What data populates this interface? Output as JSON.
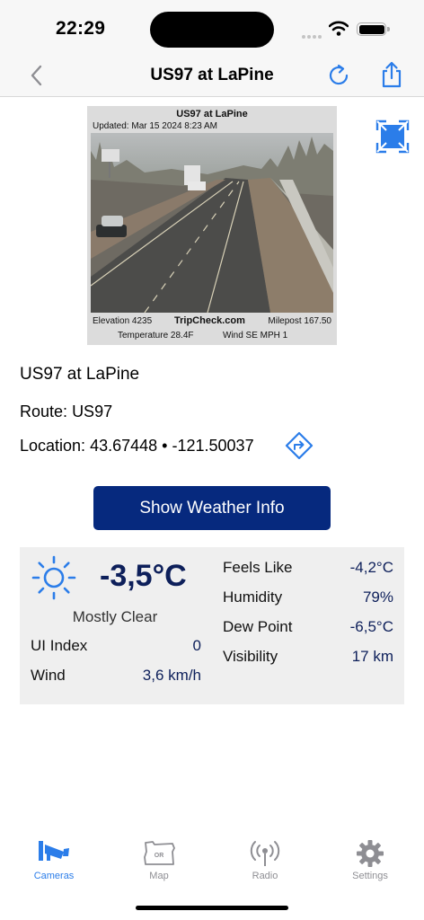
{
  "status_bar": {
    "time": "22:29"
  },
  "nav": {
    "title": "US97 at LaPine"
  },
  "camera_image": {
    "title": "US97 at LaPine",
    "updated": "Updated: Mar 15 2024  8:23 AM",
    "elevation": "Elevation 4235",
    "brand": "TripCheck.com",
    "milepost": "Milepost  167.50",
    "temperature": "Temperature 28.4F",
    "wind": "Wind SE   MPH  1"
  },
  "details": {
    "name": "US97 at LaPine",
    "route_label": "Route:",
    "route_value": "US97",
    "location_label": "Location:",
    "latitude": "43.67448",
    "separator": "•",
    "longitude": "-121.50037"
  },
  "weather_button": {
    "label": "Show Weather Info"
  },
  "weather": {
    "temperature": "-3,5°C",
    "condition": "Mostly Clear",
    "left": [
      {
        "label": "UI Index",
        "value": "0"
      },
      {
        "label": "Wind",
        "value": "3,6 km/h"
      }
    ],
    "right": [
      {
        "label": "Feels Like",
        "value": "-4,2°C"
      },
      {
        "label": "Humidity",
        "value": "79%"
      },
      {
        "label": "Dew Point",
        "value": "-6,5°C"
      },
      {
        "label": "Visibility",
        "value": "17 km"
      }
    ]
  },
  "tabs": [
    {
      "label": "Cameras",
      "icon": "camera-icon",
      "active": true
    },
    {
      "label": "Map",
      "icon": "oregon-map-icon",
      "active": false
    },
    {
      "label": "Radio",
      "icon": "radio-broadcast-icon",
      "active": false
    },
    {
      "label": "Settings",
      "icon": "gear-icon",
      "active": false
    }
  ],
  "colors": {
    "accent": "#2b7de9",
    "button": "#06297e",
    "value_text": "#0d1f5a",
    "panel": "#efefef"
  }
}
